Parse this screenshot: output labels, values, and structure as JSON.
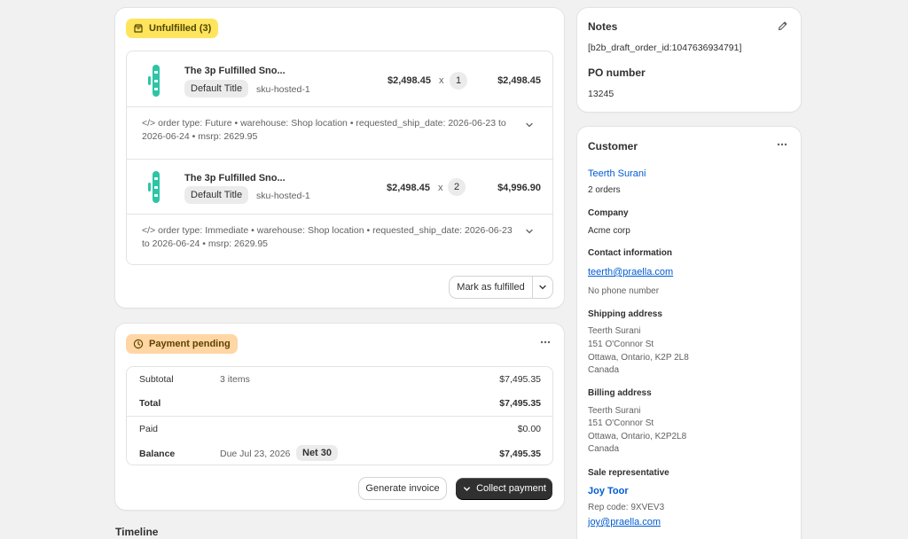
{
  "fulfillment": {
    "badge": "Unfulfilled (3)",
    "items": [
      {
        "name": "The 3p Fulfilled Sno...",
        "variant": "Default Title",
        "sku": "sku-hosted-1",
        "unit_price": "$2,498.45",
        "times": "x",
        "qty": "1",
        "total": "$2,498.45",
        "note": "</> order type: Future • warehouse: Shop location • requested_ship_date: 2026-06-23 to 2026-06-24 • msrp: 2629.95"
      },
      {
        "name": "The 3p Fulfilled Sno...",
        "variant": "Default Title",
        "sku": "sku-hosted-1",
        "unit_price": "$2,498.45",
        "times": "x",
        "qty": "2",
        "total": "$4,996.90",
        "note": "</> order type: Immediate • warehouse: Shop location • requested_ship_date: 2026-06-23 to 2026-06-24 • msrp: 2629.95"
      }
    ],
    "mark_fulfilled": "Mark as fulfilled"
  },
  "payment": {
    "badge": "Payment pending",
    "subtotal_label": "Subtotal",
    "subtotal_items": "3 items",
    "subtotal_value": "$7,495.35",
    "total_label": "Total",
    "total_value": "$7,495.35",
    "paid_label": "Paid",
    "paid_value": "$0.00",
    "balance_label": "Balance",
    "balance_due": "Due Jul 23, 2026",
    "balance_terms": "Net 30",
    "balance_value": "$7,495.35",
    "generate_invoice": "Generate invoice",
    "collect_payment": "Collect payment"
  },
  "timeline": {
    "title": "Timeline"
  },
  "notes": {
    "title": "Notes",
    "text": "[b2b_draft_order_id:1047636934791]",
    "po_title": "PO number",
    "po_value": "13245"
  },
  "customer": {
    "title": "Customer",
    "name": "Teerth Surani",
    "orders": "2 orders",
    "company_label": "Company",
    "company": "Acme corp",
    "contact_label": "Contact information",
    "email": "teerth@praella.com",
    "phone": "No phone number",
    "shipping_label": "Shipping address",
    "shipping": [
      "Teerth Surani",
      "151 O'Connor St",
      "Ottawa, Ontario, K2P 2L8",
      "Canada"
    ],
    "billing_label": "Billing address",
    "billing": [
      "Teerth Surani",
      "151 O'Connor St",
      "Ottawa, Ontario, K2P2L8",
      "Canada"
    ],
    "sale_rep_label": "Sale representative",
    "rep_name": "Joy Toor",
    "rep_code": "Rep code: 9XVEV3",
    "rep_email": "joy@praella.com"
  },
  "colors": {
    "badge_unfulfilled": "#ffe45e",
    "badge_payment": "#ffd6a4",
    "link": "#005bd3",
    "primary_button": "#303030",
    "product_thumb": "#2ec4a6"
  },
  "icons": {
    "unfulfilled_badge": "package-icon",
    "payment_badge": "clock-icon",
    "notes_edit": "pencil-icon",
    "more": "ellipsis-icon",
    "expand": "chevron-down-icon"
  }
}
